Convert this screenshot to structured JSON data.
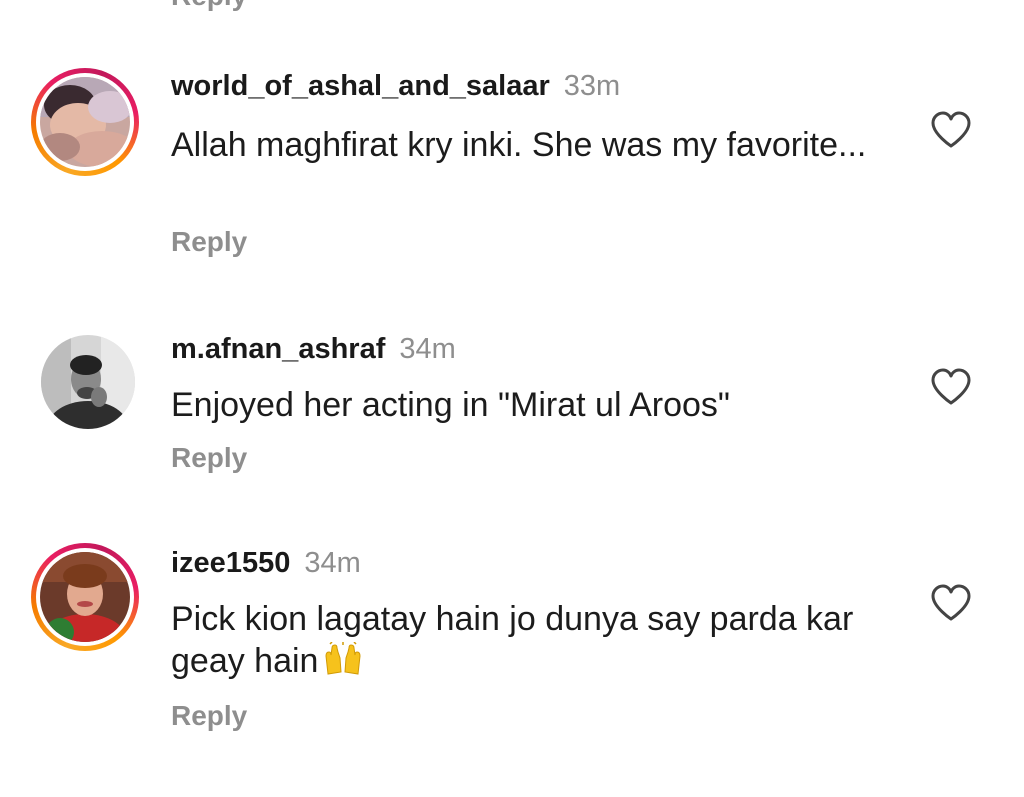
{
  "previous_reply_label": "Reply",
  "comments": [
    {
      "username": "world_of_ashal_and_salaar",
      "time": "33m",
      "text": "Allah maghfirat kry inki. She was my favorite...",
      "reply_label": "Reply",
      "has_story_ring": true,
      "avatar": "baby-photo"
    },
    {
      "username": "m.afnan_ashraf",
      "time": "34m",
      "text": "Enjoyed her acting in \"Mirat ul Aroos\"",
      "reply_label": "Reply",
      "has_story_ring": false,
      "avatar": "man-photo"
    },
    {
      "username": "izee1550",
      "time": "34m",
      "text": "Pick kion lagatay hain jo dunya say parda kar geay hain",
      "emoji": "raising-hands",
      "reply_label": "Reply",
      "has_story_ring": true,
      "avatar": "woman-photo"
    }
  ],
  "colors": {
    "username": "#1a1a1a",
    "secondary": "#8e8e8e",
    "text": "#1c1c1c",
    "ring_start": "#f9a825",
    "ring_end": "#e91e63"
  },
  "icons": {
    "like": "heart-outline-icon"
  }
}
